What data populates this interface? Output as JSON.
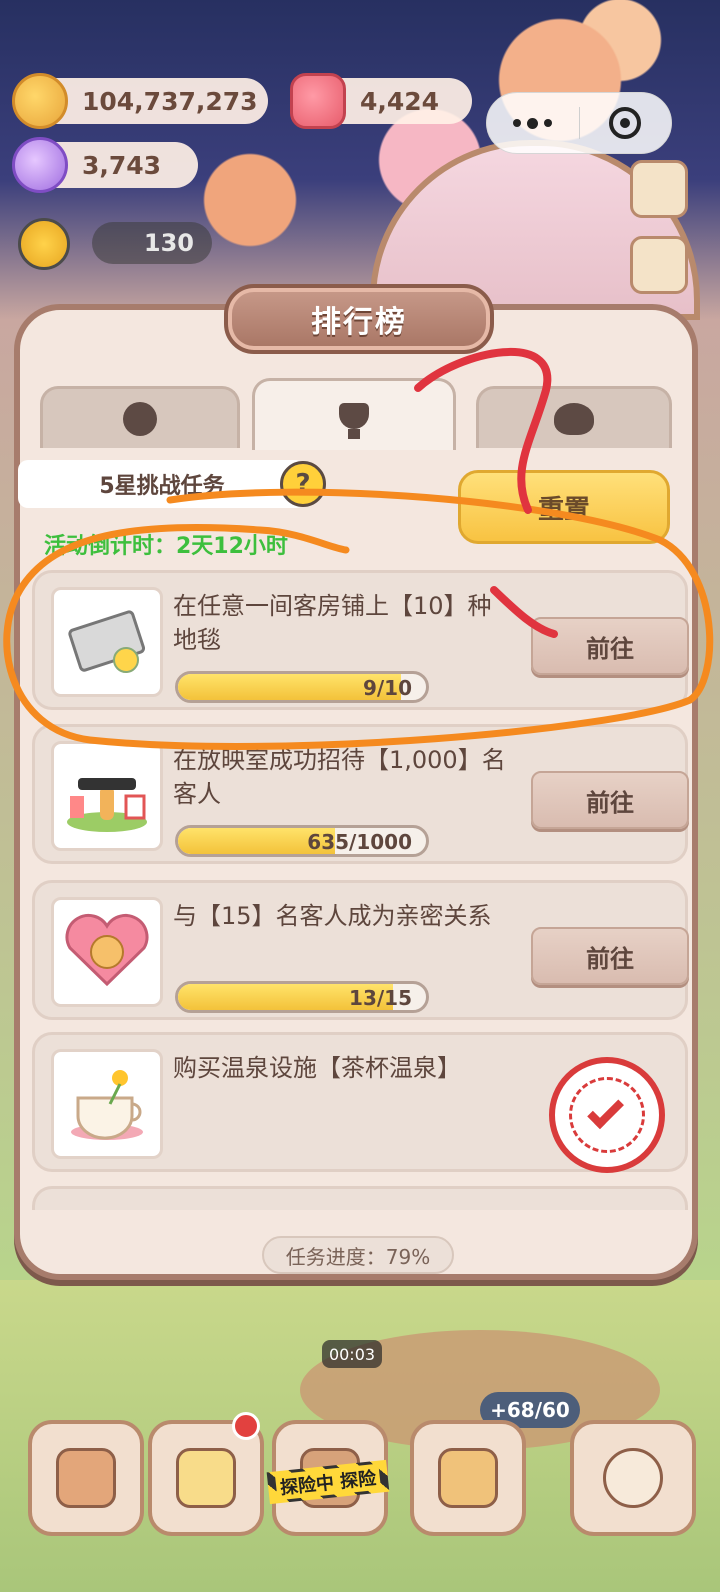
{
  "resources": {
    "cookies": "104,737,273",
    "hearts": "4,424",
    "gems": "3,743",
    "sun_count": "130"
  },
  "panel": {
    "title": "排行榜",
    "tabs": [
      {
        "icon": "character-icon"
      },
      {
        "icon": "trophy-icon",
        "active": true
      },
      {
        "icon": "cookie-icon"
      }
    ],
    "task_label": "5星挑战任务",
    "help_symbol": "?",
    "reset_button": "重置",
    "countdown": "活动倒计时：2天12小时",
    "tasks": [
      {
        "desc": "在任意一间客房铺上【10】种地毯",
        "progress_text": "9/10",
        "progress": 0.9,
        "button": "前往",
        "icon": "carpet-icon"
      },
      {
        "desc": "在放映室成功招待【1,000】名客人",
        "progress_text": "635/1000",
        "progress": 0.635,
        "button": "前往",
        "icon": "cinema-icon"
      },
      {
        "desc": "与【15】名客人成为亲密关系",
        "progress_text": "13/15",
        "progress": 0.867,
        "button": "前往",
        "icon": "heart-friend-icon"
      },
      {
        "desc": "购买温泉设施【茶杯温泉】",
        "completed": true,
        "icon": "teacup-hotspring-icon"
      }
    ],
    "overall_progress": "任务进度：79%"
  },
  "bottom": {
    "timer": "00:03",
    "energy": "+68/60",
    "adventure_sign": "探险中 探险"
  },
  "colors": {
    "panel_bg": "#f4e7df",
    "panel_border": "#a77c6c",
    "countdown_green": "#3dbf3d",
    "progress_yellow": "#f3c23a",
    "stamp_red": "#d93b3b",
    "annotation_orange": "#f58a1f",
    "annotation_red": "#e0343f"
  }
}
